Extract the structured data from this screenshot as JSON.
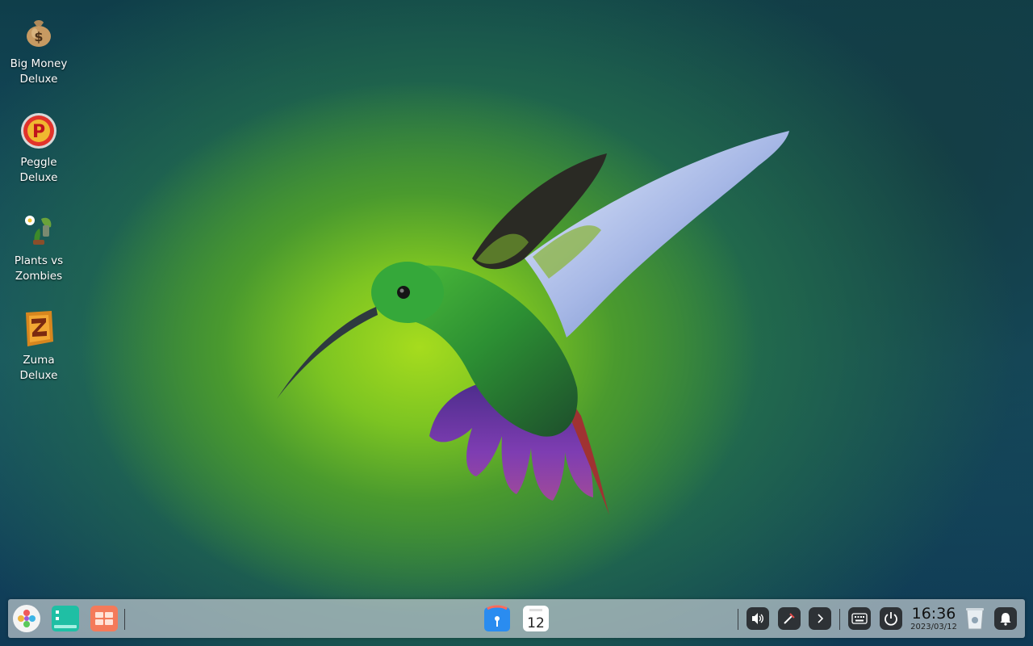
{
  "desktop": {
    "icons": [
      {
        "label": "Big Money\nDeluxe",
        "icon": "money-bag-icon"
      },
      {
        "label": "Peggle\nDeluxe",
        "icon": "peggle-icon"
      },
      {
        "label": "Plants vs\nZombies",
        "icon": "plants-vs-zombies-icon"
      },
      {
        "label": "Zuma\nDeluxe",
        "icon": "zuma-icon"
      }
    ]
  },
  "dock": {
    "left_apps": [
      "launcher-icon",
      "multitasking-view-icon",
      "desktop-grid-icon"
    ],
    "center_apps": [
      "app-store-icon",
      "calendar-icon"
    ],
    "calendar_day": "12",
    "tray": [
      "volume-icon",
      "screen-projection-icon",
      "expand-tray-icon",
      "keyboard-icon",
      "power-icon"
    ],
    "clock": {
      "time": "16:36",
      "date": "2023/03/12"
    }
  },
  "colors": {
    "dock_bg": "#bec8cd",
    "tray_button": "#2e3236",
    "wallpaper_glow": "#a6dc1e"
  }
}
